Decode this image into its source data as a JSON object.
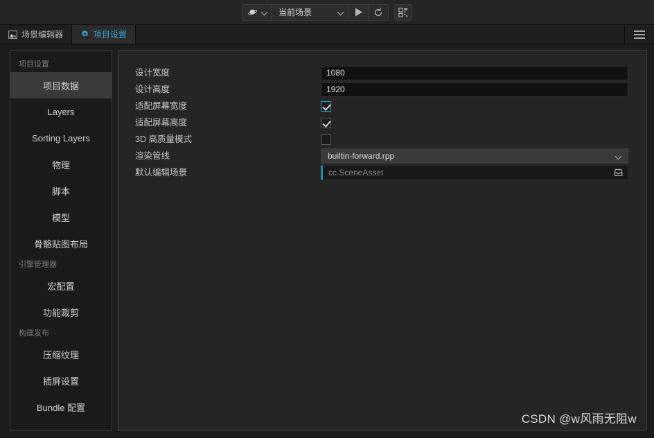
{
  "toolbar": {
    "device_icon": "planet-icon",
    "device_caret_icon": "chevron-down-icon",
    "scene_select_value": "当前场景",
    "scene_caret_icon": "chevron-down-icon",
    "play_icon": "play-icon",
    "refresh_icon": "refresh-icon",
    "qr_icon": "qr-code-icon"
  },
  "tabs": [
    {
      "label": "场景编辑器",
      "icon": "scene-image-icon",
      "active": false
    },
    {
      "label": "项目设置",
      "icon": "gear-icon",
      "active": true
    }
  ],
  "menu_icon": "hamburger-menu-icon",
  "sidebar": {
    "groups": [
      {
        "title": "项目设置",
        "items": [
          {
            "label": "项目数据",
            "active": true
          },
          {
            "label": "Layers",
            "active": false
          },
          {
            "label": "Sorting Layers",
            "active": false
          },
          {
            "label": "物理",
            "active": false
          },
          {
            "label": "脚本",
            "active": false
          },
          {
            "label": "模型",
            "active": false
          },
          {
            "label": "骨骼贴图布局",
            "active": false
          }
        ]
      },
      {
        "title": "引擎管理器",
        "items": [
          {
            "label": "宏配置",
            "active": false
          },
          {
            "label": "功能裁剪",
            "active": false
          }
        ]
      },
      {
        "title": "构建发布",
        "items": [
          {
            "label": "压缩纹理",
            "active": false
          },
          {
            "label": "插屏设置",
            "active": false
          },
          {
            "label": "Bundle 配置",
            "active": false
          }
        ]
      }
    ]
  },
  "form": {
    "rows": [
      {
        "label": "设计宽度",
        "type": "text",
        "value": "1080"
      },
      {
        "label": "设计高度",
        "type": "text",
        "value": "1920"
      },
      {
        "label": "适配屏幕宽度",
        "type": "checkbox",
        "checked": true,
        "focused": true
      },
      {
        "label": "适配屏幕高度",
        "type": "checkbox",
        "checked": true,
        "focused": false
      },
      {
        "label": "3D 高质量模式",
        "type": "checkbox",
        "checked": false,
        "focused": false
      },
      {
        "label": "渲染管线",
        "type": "select",
        "value": "builtin-forward.rpp"
      },
      {
        "label": "默认编辑场景",
        "type": "asset",
        "placeholder": "cc.SceneAsset",
        "picker_icon": "tray-icon"
      }
    ]
  },
  "watermark": "CSDN @w风雨无阻w",
  "colors": {
    "accent": "#33a6d6",
    "checkbox_focus": "#2aa9e0",
    "asset_accent": "#1b8db5",
    "panel_bg": "#252525",
    "window_bg": "#1c1c1c",
    "sidebar_bg": "#1a1a1a",
    "sidebar_active": "#3a3a3a"
  }
}
